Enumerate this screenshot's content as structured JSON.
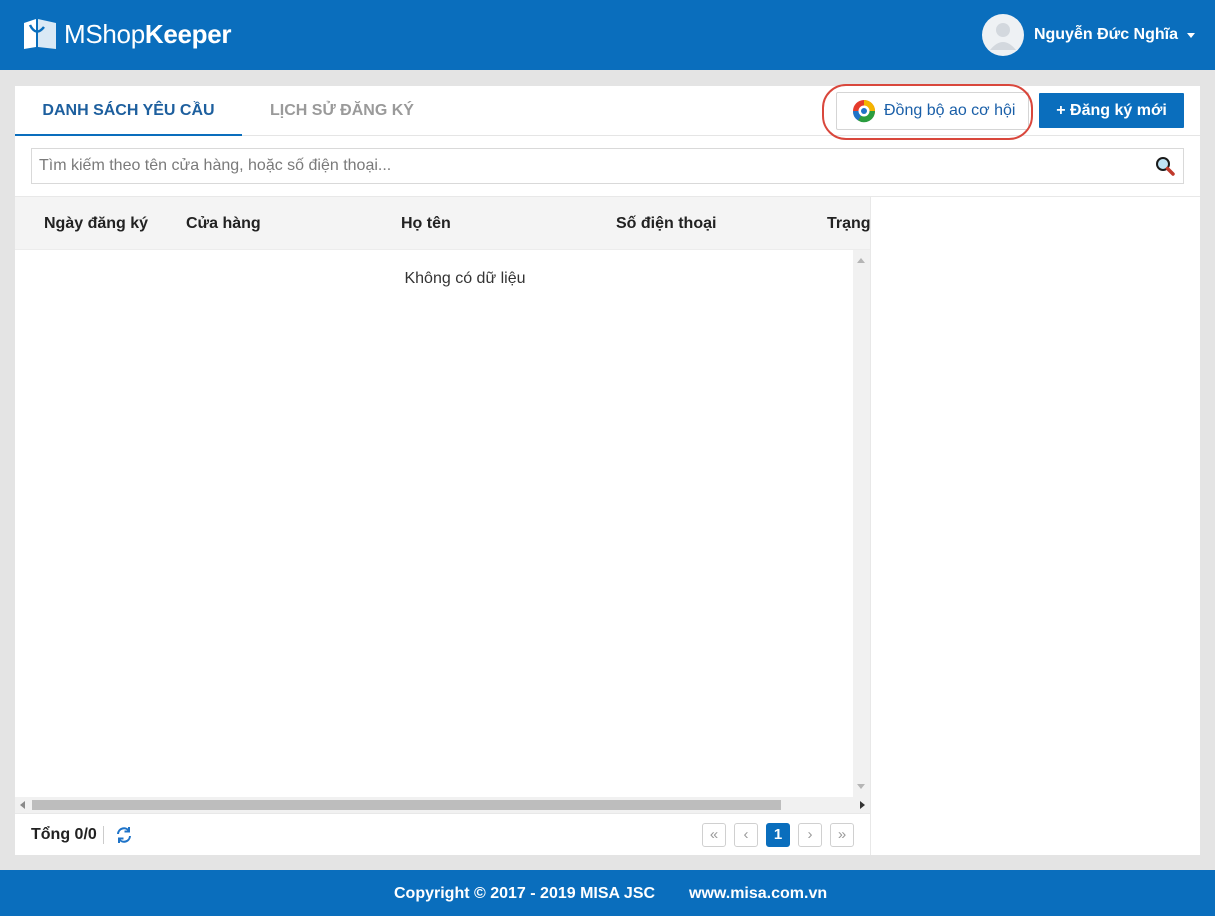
{
  "header": {
    "logo_text_light": "MShop",
    "logo_text_bold": "Keeper",
    "user_name": "Nguyễn Đức Nghĩa"
  },
  "tabs": [
    {
      "label": "DANH SÁCH YÊU CẦU",
      "active": true
    },
    {
      "label": "LỊCH SỬ ĐĂNG KÝ",
      "active": false
    }
  ],
  "actions": {
    "sync_label": "Đồng bộ ao cơ hội",
    "new_label": "+ Đăng ký mới"
  },
  "search": {
    "placeholder": "Tìm kiếm theo tên cửa hàng, hoặc số điện thoại...",
    "value": ""
  },
  "table": {
    "columns": [
      "Ngày đăng ký",
      "Cửa hàng",
      "Họ tên",
      "Số điện thoại",
      "Trạng thái"
    ],
    "rows": [],
    "empty_text": "Không có dữ liệu"
  },
  "pagination": {
    "total_label": "Tổng 0/0",
    "first": "«",
    "prev": "‹",
    "current_page": "1",
    "next": "›",
    "last": "»"
  },
  "footer": {
    "copyright": "Copyright © 2017 - 2019 MISA JSC",
    "website": "www.misa.com.vn"
  },
  "colors": {
    "brand_blue": "#0a6ebd",
    "highlight_red": "#d9473c"
  }
}
